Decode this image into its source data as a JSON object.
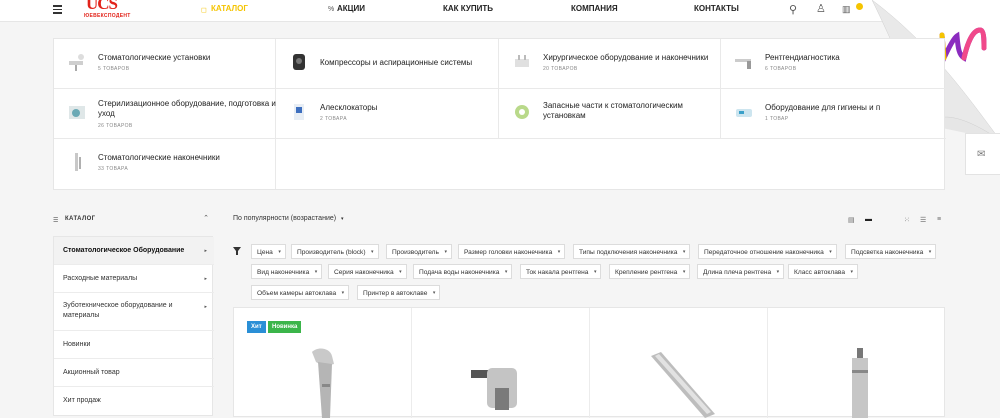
{
  "header": {
    "logo_main": "UCS",
    "logo_sub": "ЮЕВЕКСПОДЕНТ",
    "nav": [
      {
        "label": "Каталог",
        "icon": "grid-icon",
        "active": true
      },
      {
        "label": "Акции",
        "icon": "percent-icon",
        "active": false
      },
      {
        "label": "Как купить",
        "active": false
      },
      {
        "label": "Компания",
        "active": false
      },
      {
        "label": "Контакты",
        "active": false
      }
    ],
    "accent": "#f5c400"
  },
  "categories": [
    {
      "name": "Стоматологические установки",
      "count": "5 товаров"
    },
    {
      "name": "Компрессоры и аспирационные системы",
      "count": ""
    },
    {
      "name": "Хирургическое оборудование и наконечники",
      "count": "20 товаров"
    },
    {
      "name": "Рентгендиагностика",
      "count": "6 товаров"
    },
    {
      "name": "Стерилизационное оборудование, подготовка и уход",
      "count": "26 товаров"
    },
    {
      "name": "Алесклокаторы",
      "count": "2 товара"
    },
    {
      "name": "Запасные части к стоматологическим установкам",
      "count": ""
    },
    {
      "name": "Оборудование для гигиены и п",
      "count": "1 товар"
    },
    {
      "name": "Стоматологические наконечники",
      "count": "33 товара"
    }
  ],
  "sidebar": {
    "title": "Каталог",
    "items": [
      {
        "label": "Стоматологическое Оборудование",
        "arrow": "▸",
        "active": true
      },
      {
        "label": "Расходные материалы",
        "arrow": "▸",
        "active": false
      },
      {
        "label": "Зуботехническое оборудование и материалы",
        "arrow": "▸",
        "active": false
      },
      {
        "label": "Новинки",
        "arrow": "",
        "active": false
      },
      {
        "label": "Акционный товар",
        "arrow": "",
        "active": false
      },
      {
        "label": "Хит продаж",
        "arrow": "",
        "active": false
      }
    ]
  },
  "sort": {
    "label": "По популярности (возрастание)"
  },
  "filters": [
    [
      "Цена",
      "Производитель (block)",
      "Производитель",
      "Размер головки наконечника",
      "Типы подключения наконечника",
      "Передаточное отношение наконечника",
      "Подсветка наконечника"
    ],
    [
      "Вид наконечника",
      "Серия наконечника",
      "Подача воды наконечника",
      "Ток накала рентгена",
      "Крепление рентгена",
      "Длина плеча рентгена",
      "Класс автоклава"
    ],
    [
      "Объем камеры автоклава",
      "Принтер в автоклаве"
    ]
  ],
  "product_tags": [
    {
      "label": "Хит",
      "color": "#2a8fd6"
    },
    {
      "label": "Новинка",
      "color": "#3bb54a"
    }
  ]
}
